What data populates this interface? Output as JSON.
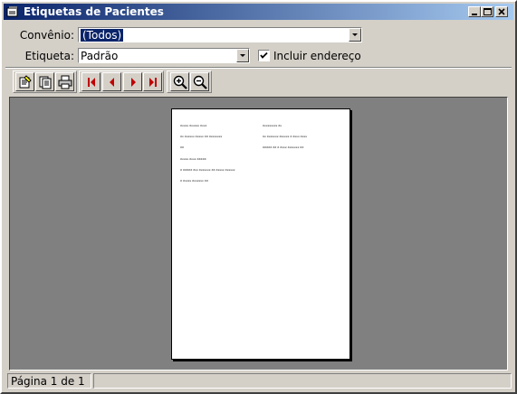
{
  "window": {
    "title": "Etiquetas de Pacientes"
  },
  "filters": {
    "convenio_label": "Convênio:",
    "convenio_value": "(Todos)",
    "etiqueta_label": "Etiqueta:",
    "etiqueta_value": "Padrão",
    "incluir_endereco_label": "Incluir endereço",
    "incluir_endereco_checked": true
  },
  "toolbar": {
    "buttons": [
      "page-setup-icon",
      "export-icon",
      "print-icon",
      "first-page-icon",
      "prev-page-icon",
      "next-page-icon",
      "last-page-icon",
      "zoom-in-icon",
      "zoom-out-icon"
    ]
  },
  "preview": {
    "labels": [
      {
        "lines": [
          "Xxxxx Xxxxxx Xxxx",
          "Xx Xxxxxx Xxxxx XX Xxxxxxxx",
          "XX"
        ]
      },
      {
        "lines": [
          "Xxxxxxxxx Xx",
          "Xx Xxxxxxx Xxxxxx X Xxxx Xxxx",
          "XXXXX XX X Xxxx Xxxxxxx XX"
        ]
      },
      {
        "lines": [
          "Xxxxx Xxxx XXXXX",
          "X XXXXX Xxx Xxxxxxx XX Xxxxx Xxxxxx",
          "X Xxxxx Xxxxxxx XX"
        ]
      }
    ]
  },
  "statusbar": {
    "page_text": "Página 1 de 1"
  },
  "colors": {
    "titlebar_start": "#0a246a",
    "titlebar_end": "#a6caf0",
    "face": "#d4d0c8",
    "preview_bg": "#808080"
  }
}
